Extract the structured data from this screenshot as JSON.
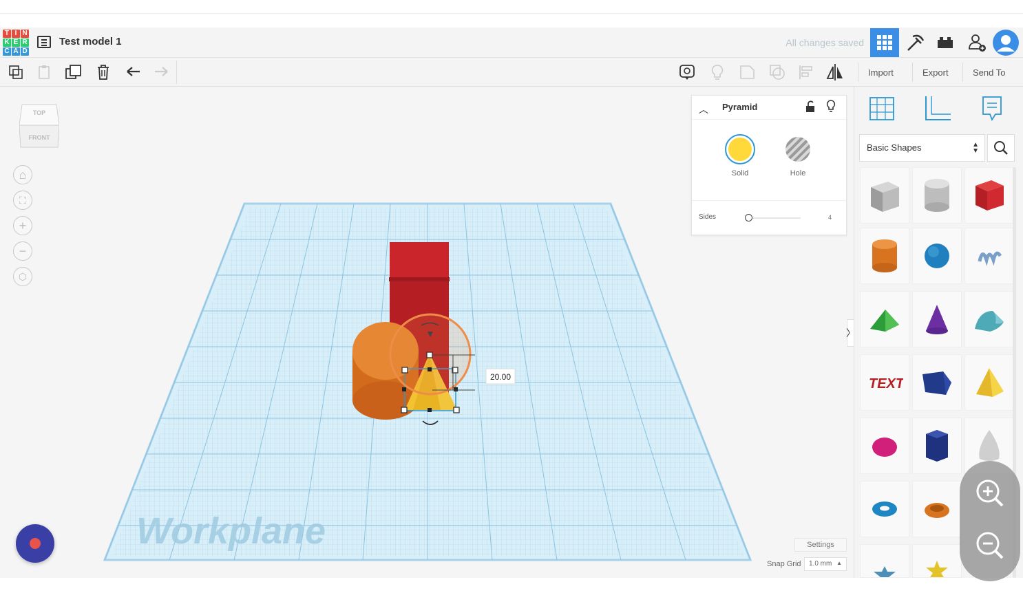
{
  "app": {
    "name": "Tinkercad",
    "logo_letters": [
      "T",
      "I",
      "N",
      "K",
      "E",
      "R",
      "C",
      "A",
      "D"
    ],
    "logo_colors": [
      "#e74c3c",
      "#e74c3c",
      "#e74c3c",
      "#2ecc71",
      "#2ecc71",
      "#2ecc71",
      "#3498db",
      "#3498db",
      "#3498db"
    ]
  },
  "header": {
    "title": "Test model 1",
    "saved_status": "All changes saved"
  },
  "toolbar": {
    "import_label": "Import",
    "export_label": "Export",
    "send_to_label": "Send To"
  },
  "viewcube": {
    "top_label": "TOP",
    "front_label": "FRONT"
  },
  "workplane": {
    "label": "Workplane",
    "dimension_value": "20.00"
  },
  "props": {
    "shape_name": "Pyramid",
    "solid_label": "Solid",
    "hole_label": "Hole",
    "sides_label": "Sides",
    "sides_value": "4",
    "solid_color": "#ffd83a"
  },
  "library": {
    "category": "Basic Shapes",
    "shapes": [
      "box",
      "cylinder-hole",
      "box-red",
      "cylinder",
      "sphere",
      "scribble",
      "roof",
      "cone",
      "round-roof",
      "text",
      "wedge",
      "pyramid",
      "half-sphere",
      "polygon",
      "paraboloid",
      "torus",
      "tube",
      "star"
    ]
  },
  "bottom": {
    "settings_label": "Settings",
    "snap_grid_label": "Snap Grid",
    "snap_grid_value": "1.0 mm"
  }
}
